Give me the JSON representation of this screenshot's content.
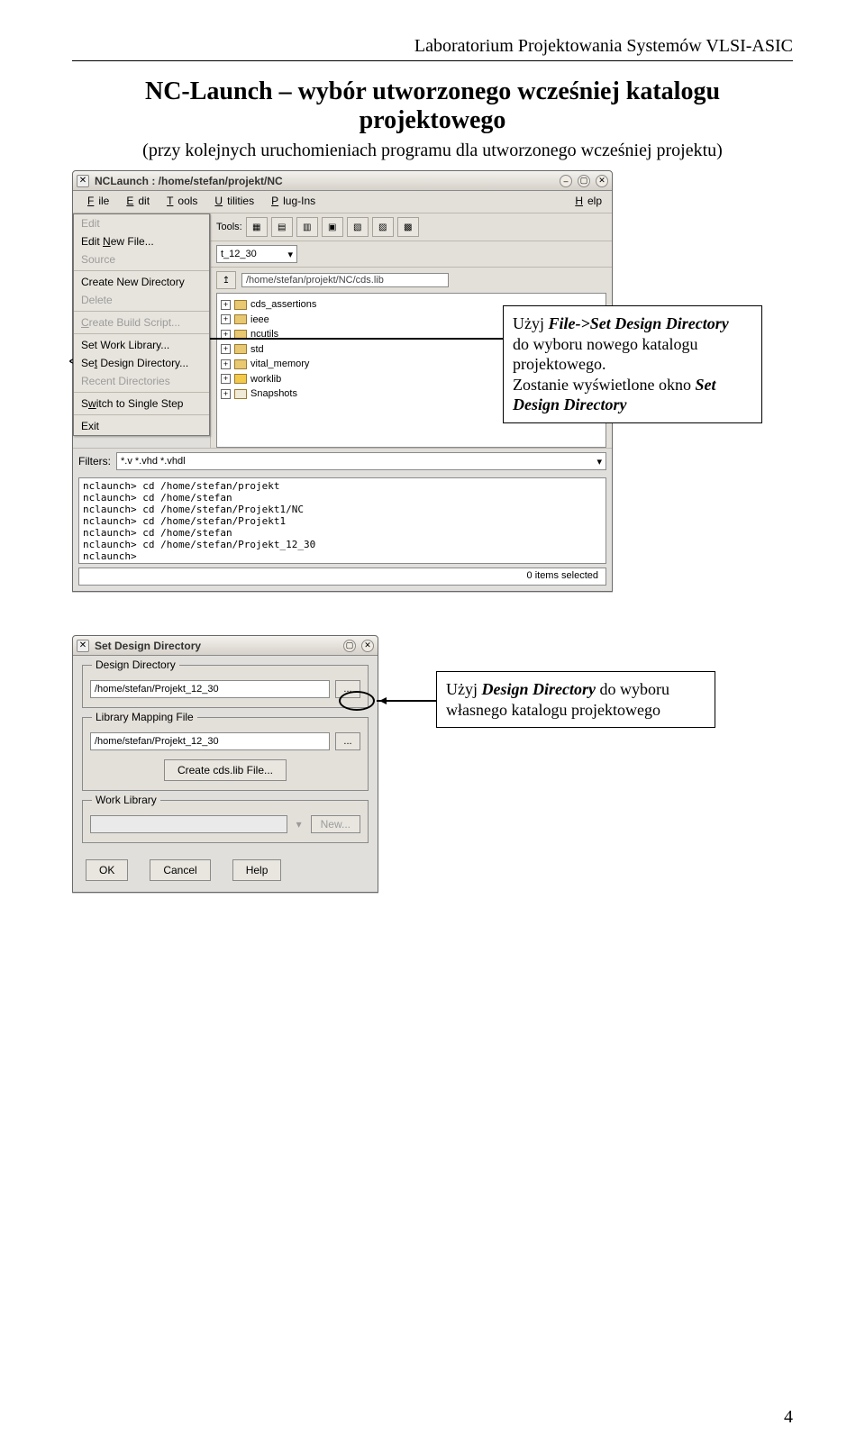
{
  "header": "Laboratorium Projektowania Systemów VLSI-ASIC",
  "title": "NC-Launch – wybór utworzonego wcześniej katalogu projektowego",
  "subtitle": "(przy kolejnych uruchomieniach programu dla utworzonego wcześniej projektu)",
  "page_num": "4",
  "nclaunch": {
    "title": "NCLaunch : /home/stefan/projekt/NC",
    "menus": [
      "File",
      "Edit",
      "Tools",
      "Utilities",
      "Plug-Ins",
      "Help"
    ],
    "file_menu": {
      "edit": "Edit",
      "edit_new": "Edit New File...",
      "source": "Source",
      "create_dir": "Create New Directory",
      "delete": "Delete",
      "build_script": "Create Build Script...",
      "set_work": "Set Work Library...",
      "set_design": "Set Design Directory...",
      "recent": "Recent Directories",
      "switch": "Switch to Single Step",
      "exit": "Exit"
    },
    "design_box": "t_12_30",
    "lib_path": "/home/stefan/projekt/NC/cds.lib",
    "tree": [
      "cds_assertions",
      "ieee",
      "ncutils",
      "std",
      "vital_memory",
      "worklib",
      "Snapshots"
    ],
    "filters_label": "Filters:",
    "filters_value": "*.v *.vhd *.vhdl",
    "log": [
      "nclaunch> cd /home/stefan/projekt",
      "nclaunch> cd /home/stefan",
      "nclaunch> cd /home/stefan/Projekt1/NC",
      "nclaunch> cd /home/stefan/Projekt1",
      "nclaunch> cd /home/stefan",
      "nclaunch> cd /home/stefan/Projekt_12_30",
      "nclaunch>"
    ],
    "status": "0 items selected"
  },
  "callout1": {
    "line1a": "Użyj ",
    "line1b": "File->Set Design Directory",
    "line2": "do wyboru nowego katalogu projektowego.",
    "line3a": "Zostanie wyświetlone okno ",
    "line3b": "Set Design Directory"
  },
  "sdd": {
    "title": "Set Design Directory",
    "design_dir": {
      "legend": "Design Directory",
      "value": "/home/stefan/Projekt_12_30"
    },
    "lib_map": {
      "legend": "Library Mapping File",
      "value": "/home/stefan/Projekt_12_30",
      "btn": "Create cds.lib File..."
    },
    "work_lib": {
      "legend": "Work Library",
      "btn": "New..."
    },
    "ok": "OK",
    "cancel": "Cancel",
    "help": "Help"
  },
  "callout2": {
    "line1a": "Użyj ",
    "line1b": "Design Directory",
    "line1c": " do wyboru własnego katalogu projektowego"
  }
}
